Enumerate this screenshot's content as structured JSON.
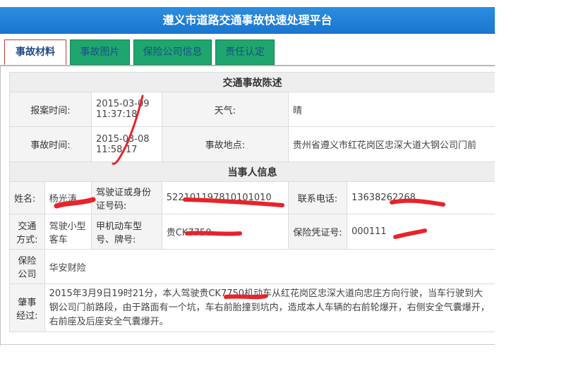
{
  "header": {
    "title": "遵义市道路交通事故快速处理平台"
  },
  "tabs": [
    {
      "label": "事故材料",
      "active": true
    },
    {
      "label": "事故图片",
      "active": false
    },
    {
      "label": "保险公司信息",
      "active": false
    },
    {
      "label": "责任认定",
      "active": false
    }
  ],
  "accident_statement": {
    "title": "交通事故陈述",
    "report_time_label": "报案时间:",
    "report_time_value": "2015-03-09 11:37:18",
    "weather_label": "天气:",
    "weather_value": "晴",
    "accident_time_label": "事故时间:",
    "accident_time_value": "2015-03-08 11:58:17",
    "location_label": "事故地点:",
    "location_value": "贵州省遵义市红花岗区忠深大道大钢公司门前"
  },
  "party_info": {
    "title": "当事人信息",
    "name_label": "姓名:",
    "name_value": "杨光涛",
    "license_label": "驾驶证或身份证号码:",
    "license_value": "522101197810101010",
    "phone_label": "联系电话:",
    "phone_value": "13638262268",
    "transport_label": "交通方式:",
    "transport_value": "驾驶小型客车",
    "vehicle_label": "甲机动车型号、牌号:",
    "vehicle_value": "贵CK7750",
    "policy_label": "保险凭证号:",
    "policy_value": "000111",
    "insurer_label": "保险公司",
    "insurer_value": "华安财险",
    "course_label": "肇事经过:",
    "course_value": "2015年3月9日19时21分，本人驾驶贵CK7750机动车从红花岗区忠深大道向忠庄方向行驶，当车行驶到大钢公司门前路段，由于路面有一个坑，车右前胎撞到坑内，造成本人车辆的右前轮爆开，右侧安全气囊爆开，右前座及后座安全气囊爆开。"
  },
  "colors": {
    "header": "#1a75cf",
    "tab_bg": "#1fa66e",
    "redaction": "#e8232a"
  }
}
